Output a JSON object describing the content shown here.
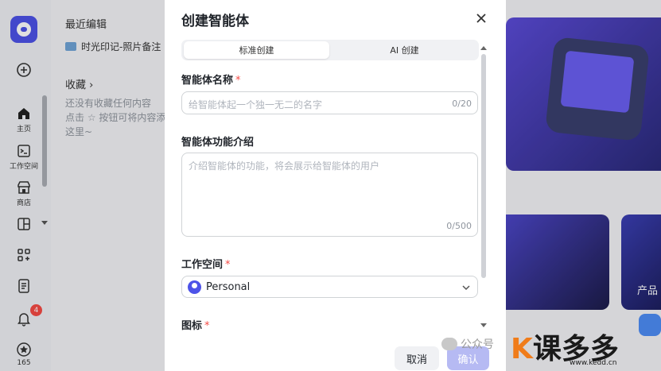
{
  "rail": {
    "home_label": "主页",
    "workspace_label": "工作空间",
    "store_label": "商店",
    "notification_count": "4",
    "bottom_count": "165"
  },
  "sidebar": {
    "recent_heading": "最近编辑",
    "recent_item": "时光印记-照片备注",
    "favorites_heading": "收藏 ›",
    "empty_line1": "还没有收藏任何内容",
    "empty_line2": "点击 ☆ 按钮可将内容添",
    "empty_line3": "这里~"
  },
  "background": {
    "card_label": "产品"
  },
  "modal": {
    "title": "创建智能体",
    "tabs": [
      {
        "label": "标准创建",
        "active": true
      },
      {
        "label": "AI 创建",
        "active": false
      }
    ],
    "name_label": "智能体名称",
    "name_placeholder": "给智能体起一个独一无二的名字",
    "name_counter": "0/20",
    "desc_label": "智能体功能介绍",
    "desc_placeholder": "介绍智能体的功能，将会展示给智能体的用户",
    "desc_counter": "0/500",
    "workspace_label": "工作空间",
    "workspace_value": "Personal",
    "icon_label": "图标",
    "required_mark": "*",
    "cancel_label": "取消",
    "confirm_label": "确认"
  },
  "watermark": {
    "text": "公众号",
    "brand_main": "课",
    "brand_rest": "多多",
    "brand_url": "www.kedd.cn"
  },
  "colors": {
    "accent": "#4d53e8",
    "required": "#f54a45",
    "confirm_disabled": "#b6baf3"
  }
}
